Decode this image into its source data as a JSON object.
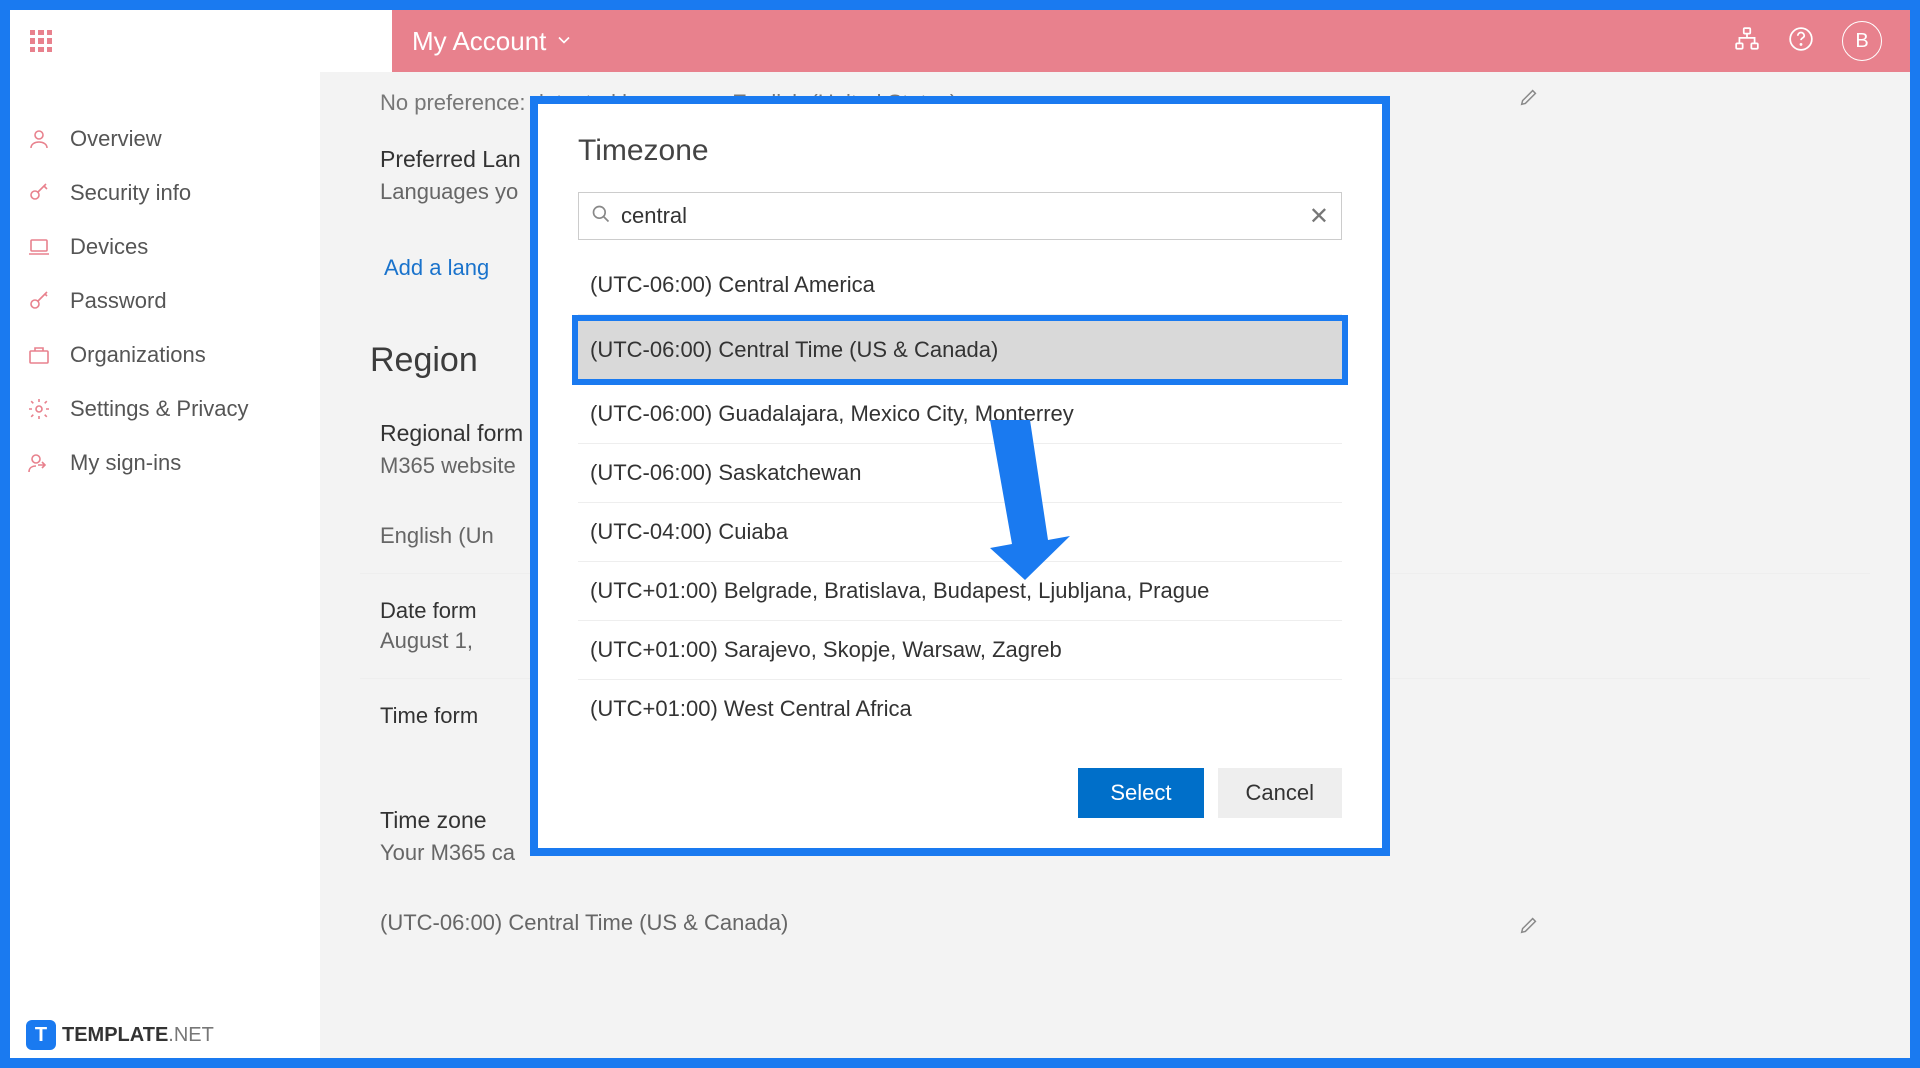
{
  "header": {
    "title": "My Account",
    "avatar_initial": "B"
  },
  "sidebar": {
    "items": [
      {
        "label": "Overview",
        "icon": "person"
      },
      {
        "label": "Security info",
        "icon": "key-shield"
      },
      {
        "label": "Devices",
        "icon": "laptop"
      },
      {
        "label": "Password",
        "icon": "key"
      },
      {
        "label": "Organizations",
        "icon": "org"
      },
      {
        "label": "Settings & Privacy",
        "icon": "gear"
      },
      {
        "label": "My sign-ins",
        "icon": "signin"
      }
    ]
  },
  "page": {
    "detected_language": "No preference: detected language - English (United States)",
    "preferred_lang": {
      "title": "Preferred Lan",
      "subtitle": "Languages yo"
    },
    "add_language_link": "Add a lang",
    "region_heading": "Region",
    "regional_format": {
      "title": "Regional form",
      "subtitle": "M365 website"
    },
    "language_value": "English (Un",
    "date_format": {
      "label": "Date form",
      "value": "August 1, "
    },
    "time_format_label": "Time form",
    "timezone_section": {
      "title": "Time zone",
      "subtitle": "Your M365 ca"
    },
    "timezone_value": "(UTC-06:00) Central Time (US & Canada)"
  },
  "modal": {
    "title": "Timezone",
    "search_value": "central",
    "options": [
      "(UTC-06:00) Central America",
      "(UTC-06:00) Central Time (US & Canada)",
      "(UTC-06:00) Guadalajara, Mexico City, Monterrey",
      "(UTC-06:00) Saskatchewan",
      "(UTC-04:00) Cuiaba",
      "(UTC+01:00) Belgrade, Bratislava, Budapest, Ljubljana, Prague",
      "(UTC+01:00) Sarajevo, Skopje, Warsaw, Zagreb",
      "(UTC+01:00) West Central Africa"
    ],
    "highlighted_index": 1,
    "select_label": "Select",
    "cancel_label": "Cancel"
  },
  "watermark": {
    "badge": "T",
    "text_bold": "TEMPLATE",
    "text_light": ".NET"
  }
}
